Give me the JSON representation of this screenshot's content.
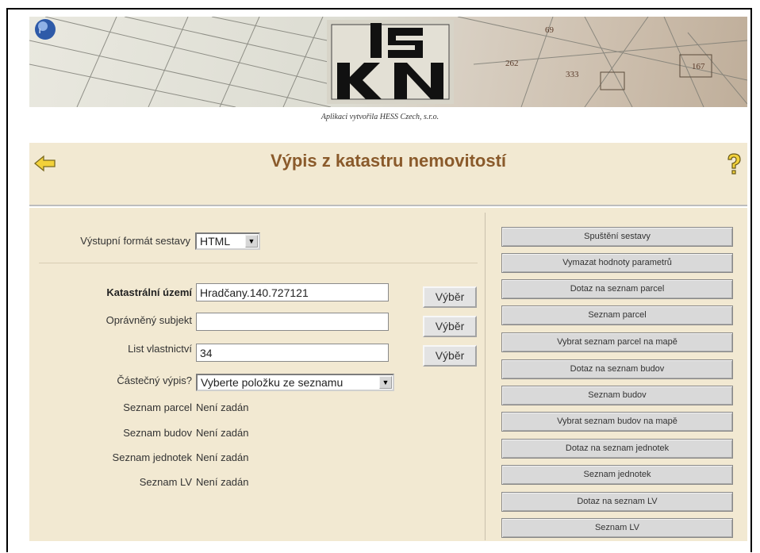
{
  "header": {
    "logo_text": "ISKN",
    "credit": "Aplikaci vytvořila HESS Czech, s.r.o."
  },
  "page": {
    "title": "Výpis z katastru nemovitostí"
  },
  "icons": {
    "back": "back-arrow-icon",
    "help": "question-mark-icon",
    "corner": "corner-badge-icon"
  },
  "colors": {
    "panel_background": "#f2e9d2",
    "title_color": "#8a5a2b",
    "arrow_yellow": "#f2d13a"
  },
  "form": {
    "output_format": {
      "label": "Výstupní formát sestavy",
      "value": "HTML"
    },
    "cadastral_area": {
      "label": "Katastrální území",
      "value": "Hradčany.140.727121",
      "button": "Výběr"
    },
    "authorized_subject": {
      "label": "Oprávněný subjekt",
      "value": "",
      "button": "Výběr"
    },
    "ownership_sheet": {
      "label": "List vlastnictví",
      "value": "34",
      "button": "Výběr"
    },
    "partial_extract": {
      "label": "Částečný výpis?",
      "value": "Vyberte položku ze seznamu"
    },
    "parcels": {
      "label": "Seznam parcel",
      "value": "Není zadán"
    },
    "buildings": {
      "label": "Seznam budov",
      "value": "Není zadán"
    },
    "units": {
      "label": "Seznam jednotek",
      "value": "Není zadán"
    },
    "lv": {
      "label": "Seznam LV",
      "value": "Není zadán"
    }
  },
  "actions": [
    "Spuštění sestavy",
    "Vymazat hodnoty parametrů",
    "Dotaz na seznam parcel",
    "Seznam parcel",
    "Vybrat seznam parcel na mapě",
    "Dotaz na seznam budov",
    "Seznam budov",
    "Vybrat seznam budov na mapě",
    "Dotaz na seznam jednotek",
    "Seznam jednotek",
    "Dotaz na seznam LV",
    "Seznam LV"
  ]
}
